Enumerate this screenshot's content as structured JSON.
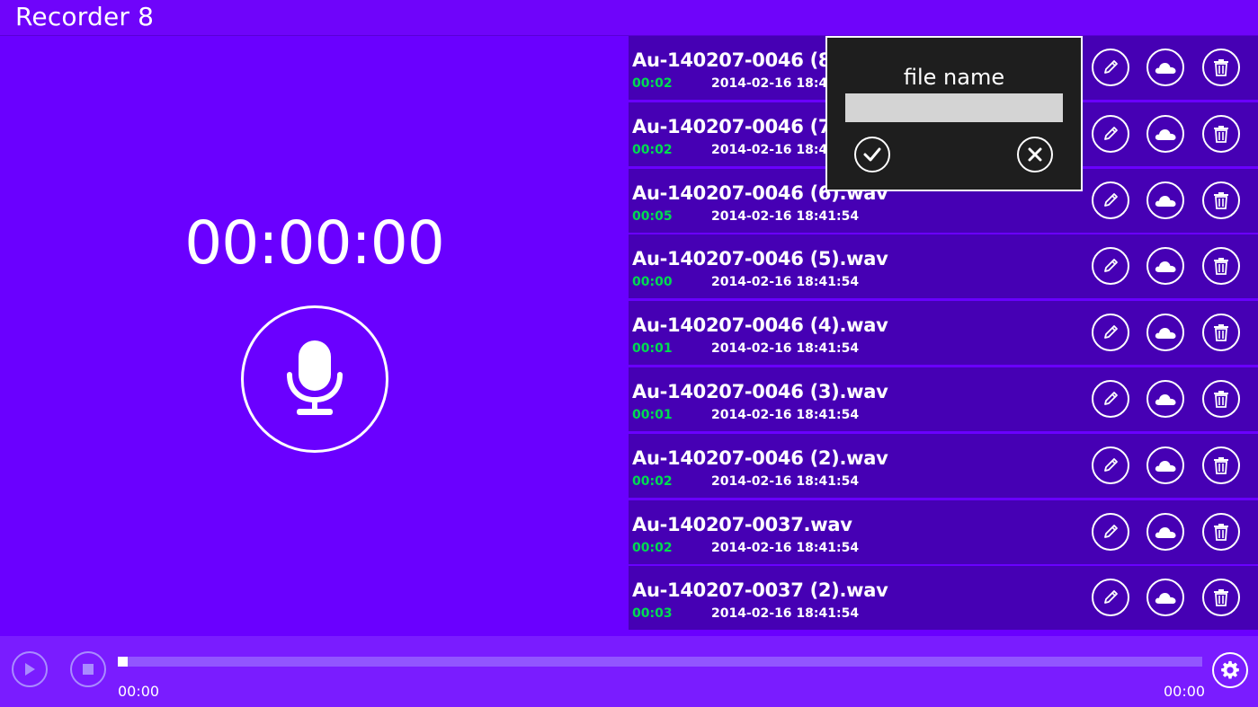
{
  "app": {
    "title": "Recorder 8"
  },
  "recorder": {
    "timer": "00:00:00",
    "mic_icon": "microphone-icon"
  },
  "recordings": [
    {
      "name": "Au-140207-0046 (8).wav",
      "duration": "00:02",
      "date": "2014-02-16 18:41:54"
    },
    {
      "name": "Au-140207-0046 (7).wav",
      "duration": "00:02",
      "date": "2014-02-16 18:41:54"
    },
    {
      "name": "Au-140207-0046 (6).wav",
      "duration": "00:05",
      "date": "2014-02-16 18:41:54"
    },
    {
      "name": "Au-140207-0046 (5).wav",
      "duration": "00:00",
      "date": "2014-02-16 18:41:54"
    },
    {
      "name": "Au-140207-0046 (4).wav",
      "duration": "00:01",
      "date": "2014-02-16 18:41:54"
    },
    {
      "name": "Au-140207-0046 (3).wav",
      "duration": "00:01",
      "date": "2014-02-16 18:41:54"
    },
    {
      "name": "Au-140207-0046 (2).wav",
      "duration": "00:02",
      "date": "2014-02-16 18:41:54"
    },
    {
      "name": "Au-140207-0037.wav",
      "duration": "00:02",
      "date": "2014-02-16 18:41:54"
    },
    {
      "name": "Au-140207-0037 (2).wav",
      "duration": "00:03",
      "date": "2014-02-16 18:41:54"
    }
  ],
  "row_icons": {
    "edit": "pencil-icon",
    "cloud": "cloud-icon",
    "delete": "trash-icon"
  },
  "rename_dialog": {
    "title": "file name",
    "input_value": "",
    "input_placeholder": "",
    "confirm_icon": "checkmark-icon",
    "cancel_icon": "close-icon"
  },
  "player": {
    "current_time": "00:00",
    "total_time": "00:00",
    "progress_fraction": 0,
    "play_icon": "play-icon",
    "stop_icon": "stop-icon",
    "settings_icon": "gear-icon"
  },
  "colors": {
    "background": "#6a00ff",
    "list_row": "#4600b4",
    "duration_text": "#00dc50",
    "dialog_bg": "#1e1e1e",
    "bottom_bar": "#7a1cff"
  }
}
